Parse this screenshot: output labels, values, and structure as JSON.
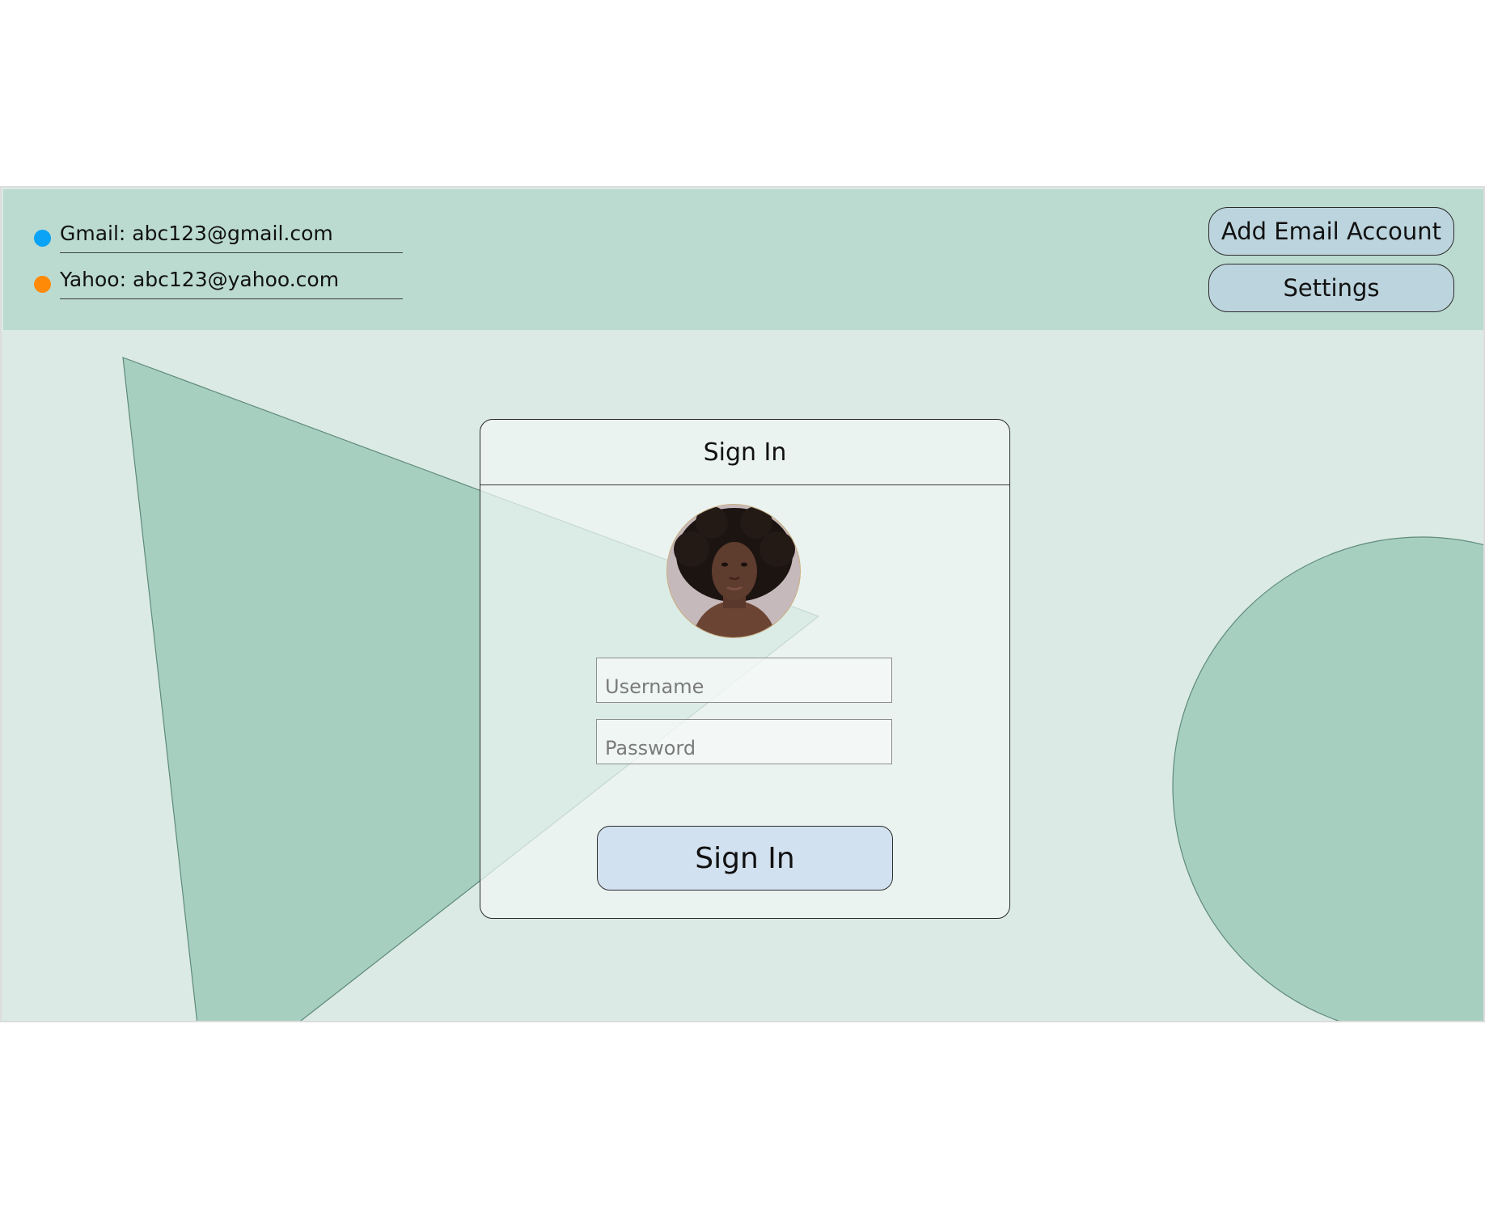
{
  "accounts": [
    {
      "label": "Gmail: abc123@gmail.com",
      "dot_color": "#0aa3f5"
    },
    {
      "label": "Yahoo: abc123@yahoo.com",
      "dot_color": "#ff8a08"
    }
  ],
  "topbar": {
    "add_account_label": "Add Email Account",
    "settings_label": "Settings"
  },
  "signin_card": {
    "title": "Sign In",
    "username_placeholder": "Username",
    "password_placeholder": "Password",
    "submit_label": "Sign In"
  },
  "colors": {
    "background": "#dbeae4",
    "topbar": "#bbdbd1",
    "shape_fill": "#a7cfc0",
    "button_fill": "#bcd4dd",
    "submit_fill": "#d2e1ef"
  }
}
